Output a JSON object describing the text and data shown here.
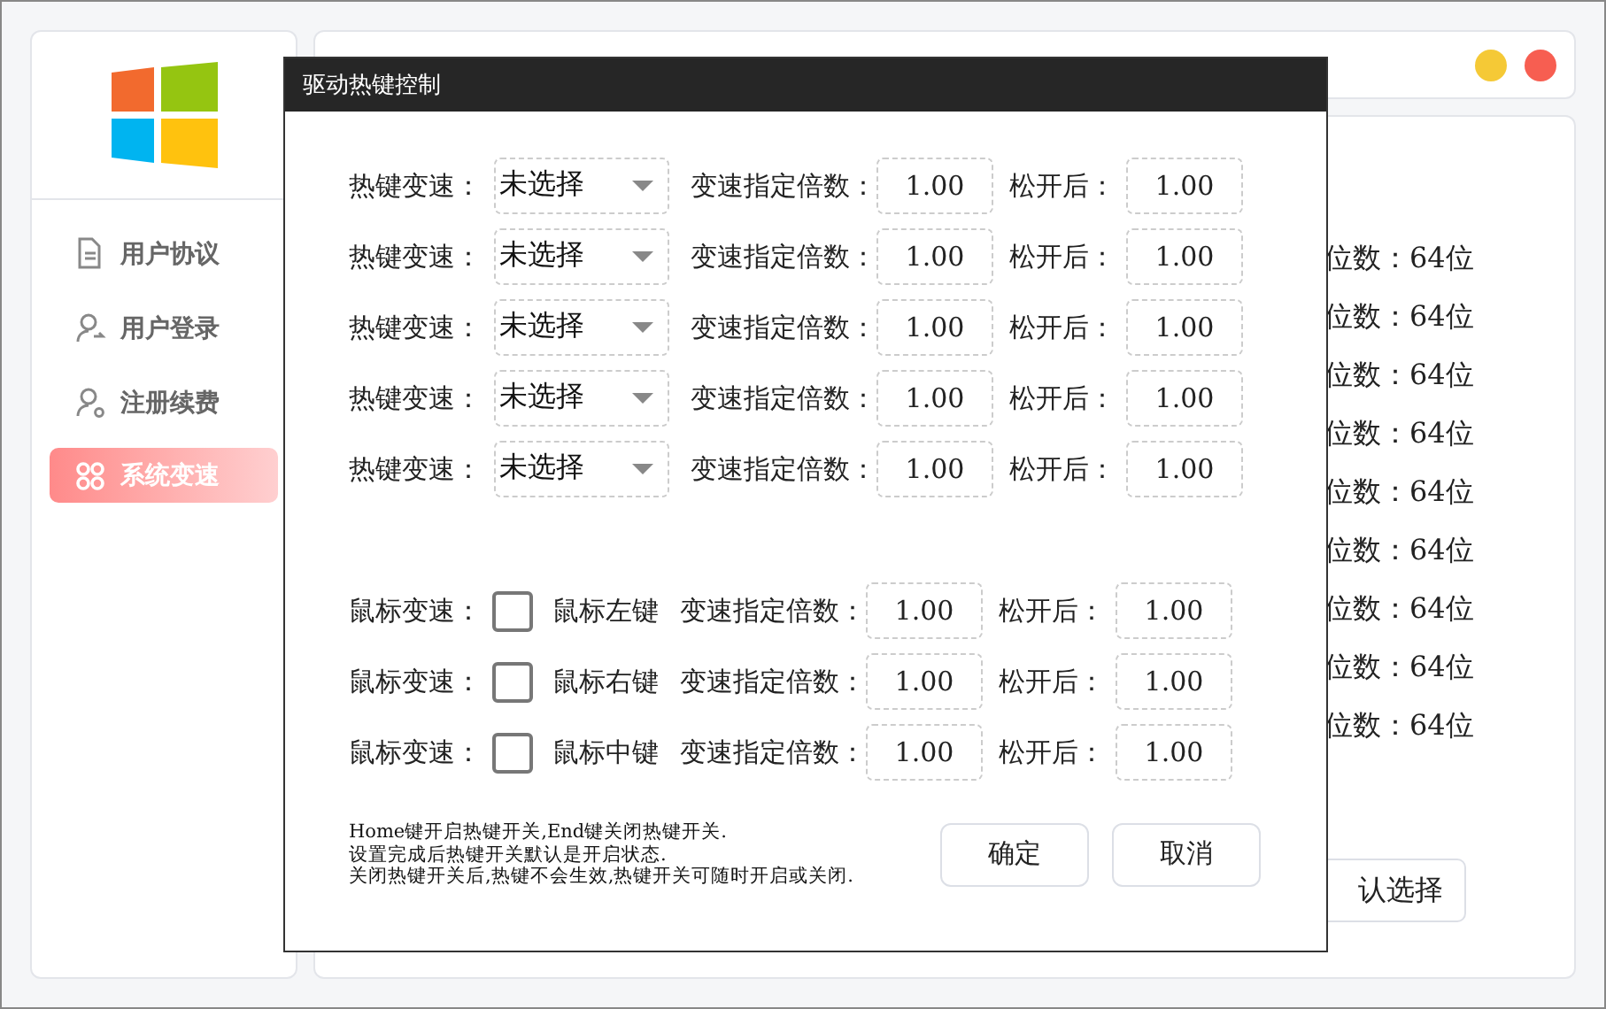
{
  "sidebar": {
    "items": [
      {
        "label": "用户协议",
        "selected": false
      },
      {
        "label": "用户登录",
        "selected": false
      },
      {
        "label": "注册续费",
        "selected": false
      },
      {
        "label": "系统变速",
        "selected": true
      }
    ]
  },
  "background_rows": [
    "位数：64位",
    "位数：64位",
    "位数：64位",
    "位数：64位",
    "位数：64位",
    "位数：64位",
    "位数：64位",
    "位数：64位",
    "位数：64位"
  ],
  "background_button": "认选择",
  "dialog": {
    "title": "驱动热键控制",
    "hotkey_rows": [
      {
        "label": "热键变速：",
        "combo": "未选择",
        "factor_label": "变速指定倍数：",
        "factor": "1.00",
        "release_label": "松开后：",
        "release": "1.00"
      },
      {
        "label": "热键变速：",
        "combo": "未选择",
        "factor_label": "变速指定倍数：",
        "factor": "1.00",
        "release_label": "松开后：",
        "release": "1.00"
      },
      {
        "label": "热键变速：",
        "combo": "未选择",
        "factor_label": "变速指定倍数：",
        "factor": "1.00",
        "release_label": "松开后：",
        "release": "1.00"
      },
      {
        "label": "热键变速：",
        "combo": "未选择",
        "factor_label": "变速指定倍数：",
        "factor": "1.00",
        "release_label": "松开后：",
        "release": "1.00"
      },
      {
        "label": "热键变速：",
        "combo": "未选择",
        "factor_label": "变速指定倍数：",
        "factor": "1.00",
        "release_label": "松开后：",
        "release": "1.00"
      }
    ],
    "mouse_rows": [
      {
        "label": "鼠标变速：",
        "checked": false,
        "button": "鼠标左键",
        "factor_label": "变速指定倍数：",
        "factor": "1.00",
        "release_label": "松开后：",
        "release": "1.00"
      },
      {
        "label": "鼠标变速：",
        "checked": false,
        "button": "鼠标右键",
        "factor_label": "变速指定倍数：",
        "factor": "1.00",
        "release_label": "松开后：",
        "release": "1.00"
      },
      {
        "label": "鼠标变速：",
        "checked": false,
        "button": "鼠标中键",
        "factor_label": "变速指定倍数：",
        "factor": "1.00",
        "release_label": "松开后：",
        "release": "1.00"
      }
    ],
    "notes": [
      "Home键开启热键开关,End键关闭热键开关.",
      "设置完成后热键开关默认是开启状态.",
      "关闭热键开关后,热键不会生效,热键开关可随时开启或关闭."
    ],
    "buttons": [
      "确定",
      "取消"
    ]
  }
}
